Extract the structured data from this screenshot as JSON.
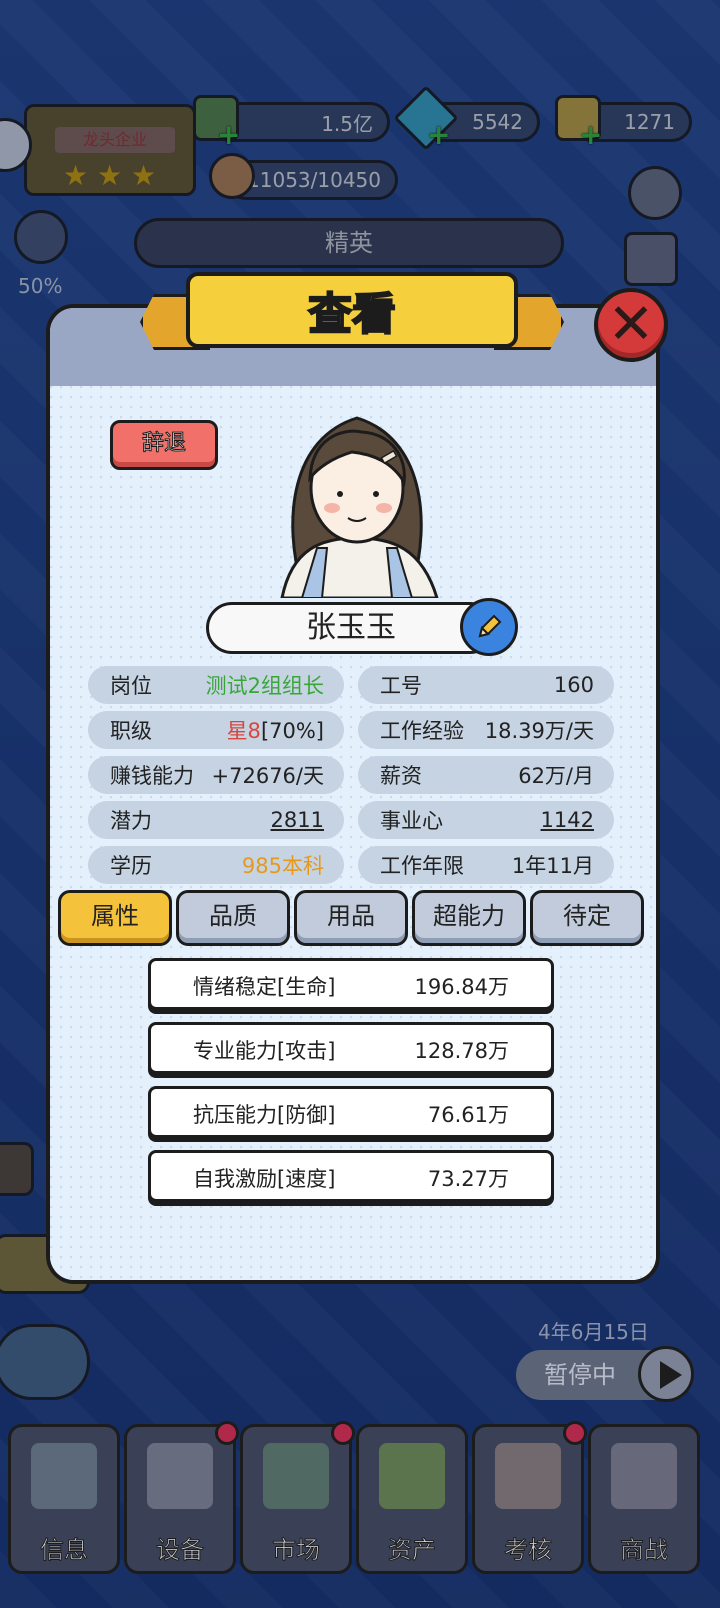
{
  "top_bar": {
    "money": "1.5亿",
    "diamonds": "5542",
    "gold": "1271",
    "reputation": "11053/10450",
    "company_level_label": "龙头企业",
    "percent": "50%",
    "rank_title": "精英"
  },
  "dialog": {
    "title": "查看",
    "dismiss_label": "辞退",
    "employee_name": "张玉玉",
    "stats": {
      "position_label": "岗位",
      "position_value": "测试2组组长",
      "id_label": "工号",
      "id_value": "160",
      "grade_label": "职级",
      "grade_value_star": "星8",
      "grade_value_pct": "[70%]",
      "exp_label": "工作经验",
      "exp_value": "18.39万/天",
      "earn_label": "赚钱能力",
      "earn_value": "+72676/天",
      "salary_label": "薪资",
      "salary_value": "62万/月",
      "potential_label": "潜力",
      "potential_value": "2811",
      "ambition_label": "事业心",
      "ambition_value": "1142",
      "education_label": "学历",
      "education_value": "985本科",
      "years_label": "工作年限",
      "years_value": "1年11月"
    },
    "tabs": [
      "属性",
      "品质",
      "用品",
      "超能力",
      "待定"
    ],
    "attributes": [
      {
        "label": "情绪稳定[生命]",
        "value": "196.84万"
      },
      {
        "label": "专业能力[攻击]",
        "value": "128.78万"
      },
      {
        "label": "抗压能力[防御]",
        "value": "76.61万"
      },
      {
        "label": "自我激励[速度]",
        "value": "73.27万"
      }
    ]
  },
  "game_date": "4年6月15日",
  "pause_label": "暂停中",
  "nav": [
    "信息",
    "设备",
    "市场",
    "资产",
    "考核",
    "商战"
  ],
  "colors": {
    "accent_yellow": "#f5c33b",
    "close_red": "#d43a3a",
    "dismiss_red": "#f2706a",
    "position_green": "#3aa63a",
    "grade_red": "#d8463c",
    "education_orange": "#e59a1e"
  }
}
